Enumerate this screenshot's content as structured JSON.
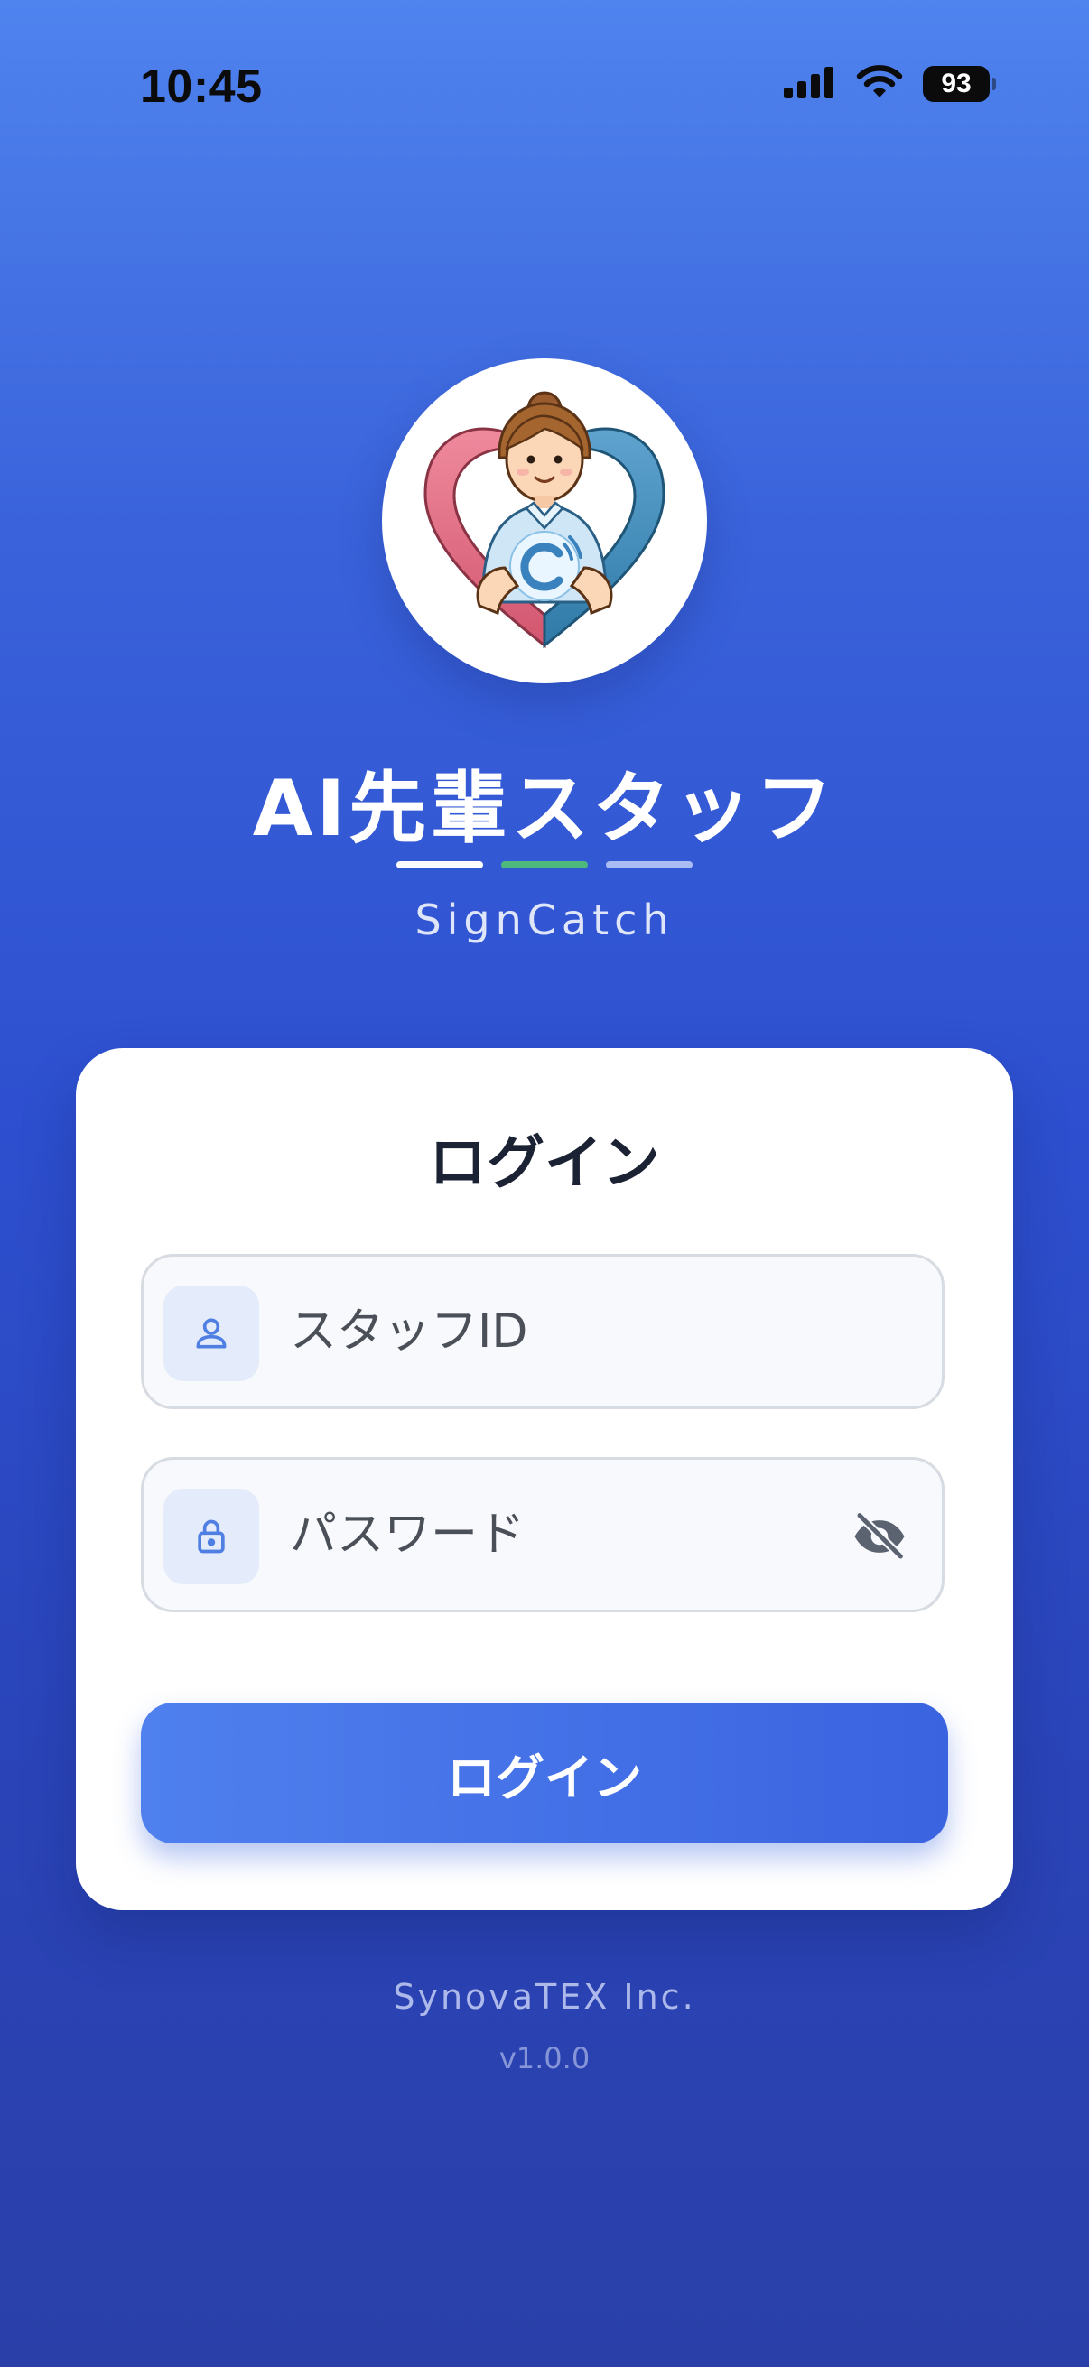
{
  "status_bar": {
    "time": "10:45",
    "battery": "93",
    "icons": [
      "signal-icon",
      "wifi-icon",
      "battery-icon"
    ]
  },
  "header": {
    "logo_icon": "staff-heart-logo",
    "title": "AI先輩スタッフ",
    "subtitle": "SignCatch",
    "accent_colors": [
      "#ffffff",
      "#4fb87c",
      "#a9bcf3"
    ]
  },
  "login_card": {
    "title": "ログイン",
    "staff_id": {
      "icon": "user-icon",
      "placeholder": "スタッフID",
      "value": ""
    },
    "password": {
      "icon": "lock-icon",
      "placeholder": "パスワード",
      "value": "",
      "toggle_icon": "eye-off-icon"
    },
    "submit_label": "ログイン"
  },
  "footer": {
    "company": "SynovaTEX Inc.",
    "version": "v1.0.0"
  },
  "colors": {
    "background_top": "#4f83ee",
    "background_bottom": "#2a3fa8",
    "button": "#3a63e0",
    "icon_accent": "#4f7fe3"
  }
}
